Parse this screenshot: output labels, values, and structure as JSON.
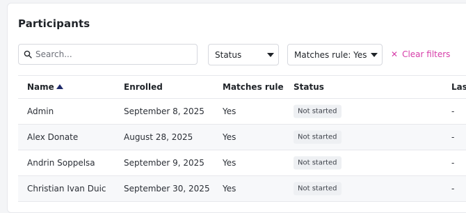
{
  "title": "Participants",
  "search": {
    "placeholder": "Search...",
    "value": ""
  },
  "filters": {
    "status_label": "Status",
    "matches_label": "Matches rule: Yes",
    "clear_label": "Clear filters"
  },
  "table": {
    "columns": {
      "name": "Name",
      "enrolled": "Enrolled",
      "matches": "Matches rule",
      "status": "Status",
      "last": "Las"
    },
    "sort": {
      "column": "Name",
      "direction": "ascending"
    },
    "rows": [
      {
        "name": "Admin",
        "enrolled": "September 8, 2025",
        "matches": "Yes",
        "status": "Not started",
        "last": "-"
      },
      {
        "name": "Alex Donate",
        "enrolled": "August 28, 2025",
        "matches": "Yes",
        "status": "Not started",
        "last": "-"
      },
      {
        "name": "Andrin Soppelsa",
        "enrolled": "September 9, 2025",
        "matches": "Yes",
        "status": "Not started",
        "last": "-"
      },
      {
        "name": "Christian Ivan Duic",
        "enrolled": "September 30, 2025",
        "matches": "Yes",
        "status": "Not started",
        "last": "-"
      }
    ]
  },
  "colors": {
    "accent": "#d63ca8",
    "sort_arrow": "#1f2a6b",
    "badge_bg": "#eef0f3"
  },
  "icons": {
    "search": "search-icon",
    "sort": "sort-ascending-icon",
    "clear": "close-icon",
    "dropdown": "chevron-down-icon"
  }
}
